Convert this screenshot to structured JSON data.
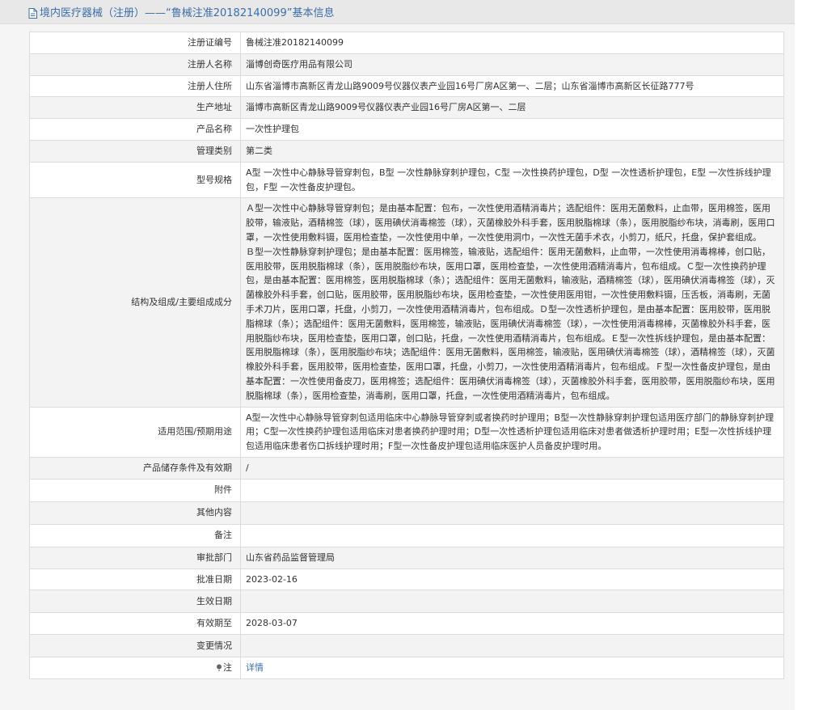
{
  "header": {
    "title": "境内医疗器械（注册）——“鲁械注准20182140099”基本信息"
  },
  "rows": [
    {
      "label": "注册证编号",
      "value": "鲁械注准20182140099"
    },
    {
      "label": "注册人名称",
      "value": "淄博创奇医疗用品有限公司"
    },
    {
      "label": "注册人住所",
      "value": "山东省淄博市高新区青龙山路9009号仪器仪表产业园16号厂房A区第一、二层；山东省淄博市高新区长征路777号"
    },
    {
      "label": "生产地址",
      "value": "淄博市高新区青龙山路9009号仪器仪表产业园16号厂房A区第一、二层"
    },
    {
      "label": "产品名称",
      "value": "一次性护理包"
    },
    {
      "label": "管理类别",
      "value": "第二类"
    },
    {
      "label": "型号规格",
      "value": "A型 一次性中心静脉导管穿刺包，B型 一次性静脉穿刺护理包，C型 一次性换药护理包，D型 一次性透析护理包，E型 一次性拆线护理包，F型 一次性备皮护理包。"
    },
    {
      "label": "结构及组成/主要组成成分",
      "value_lines": [
        "Ａ型一次性中心静脉导管穿刺包；是由基本配置：包布，一次性使用酒精消毒片；选配组件：医用无菌敷料，止血带，医用棉签，医用胶带，输液贴，酒精棉签（球），医用碘伏消毒棉签（球），灭菌橡胶外科手套，医用脱脂棉球（条），医用脱脂纱布块，消毒刷，医用口罩，一次性使用敷料镊，医用检查垫，一次性使用中单，一次性使用洞巾，一次性无菌手术衣，小剪刀，纸尺，托盘，保护套组成。",
        " Ｂ型一次性静脉穿刺护理包；是由基本配置：医用棉签，输液贴，选配组件：医用无菌敷料，止血带，一次性使用消毒棉棒，创口贴，医用胶带，医用脱脂棉球（条），医用脱脂纱布块，医用口罩，医用检查垫，一次性使用酒精消毒片，包布组成。Ｃ型一次性换药护理包，是由基本配置：医用棉签，医用脱脂棉球（条）；选配组件：医用无菌敷料，输液贴，酒精棉签（球），医用碘伏消毒棉签（球），灭菌橡胶外科手套，创口贴，医用胶带，医用脱脂纱布块，医用检查垫，一次性使用医用钳，一次性使用敷料镊，压舌板，消毒刷，无菌手术刀片，医用口罩，托盘，小剪刀，一次性使用酒精消毒片，包布组成。Ｄ型一次性透析护理包，是由基本配置：医用胶带，医用脱脂棉球（条）；选配组件：医用无菌敷料，医用棉签，输液贴，医用碘伏消毒棉签（球），一次性使用消毒棉棒，灭菌橡胶外科手套，医用脱脂纱布块，医用检查垫，医用口罩，创口贴，托盘，一次性使用酒精消毒片，包布组成。Ｅ型一次性拆线护理包，是由基本配置：医用脱脂棉球（条），医用脱脂纱布块；选配组件：医用无菌敷料，医用棉签，输液贴，医用碘伏消毒棉签（球），酒精棉签（球），灭菌橡胶外科手套，医用胶带，医用检查垫，医用口罩，托盘，小剪刀，一次性使用酒精消毒片，包布组成。Ｆ型一次性备皮护理包，是由基本配置：一次性使用备皮刀，医用棉签；选配组件：医用碘伏消毒棉签（球），灭菌橡胶外科手套，医用胶带，医用脱脂纱布块，医用脱脂棉球（条），医用检查垫，消毒刷，医用口罩，托盘，一次性使用酒精消毒片，包布组成。"
      ]
    },
    {
      "label": "适用范围/预期用途",
      "value": "A型一次性中心静脉导管穿刺包适用临床中心静脉导管穿刺或者换药时护理用；B型一次性静脉穿刺护理包适用医疗部门的静脉穿刺护理用；C型一次性换药护理包适用临床对患者换药护理时用；D型一次性透析护理包适用临床对患者做透析护理时用；E型一次性拆线护理包适用临床患者伤口拆线护理时用；F型一次性备皮护理包适用临床医护人员备皮护理时用。"
    },
    {
      "label": "产品储存条件及有效期",
      "value": "/"
    },
    {
      "label": "附件",
      "value": ""
    },
    {
      "label": "其他内容",
      "value": ""
    },
    {
      "label": "备注",
      "value": ""
    },
    {
      "label": "审批部门",
      "value": "山东省药品监督管理局"
    },
    {
      "label": "批准日期",
      "value": "2023-02-16"
    },
    {
      "label": "生效日期",
      "value": ""
    },
    {
      "label": "有效期至",
      "value": "2028-03-07"
    },
    {
      "label": "变更情况",
      "value": ""
    },
    {
      "label": "注",
      "value": "详情"
    }
  ],
  "icons": {
    "header_icon": "document-icon",
    "note_icon": "pin-icon"
  },
  "colors": {
    "title": "#3b6ea8",
    "link": "#3b6ea8",
    "border": "#dcdcdc"
  }
}
